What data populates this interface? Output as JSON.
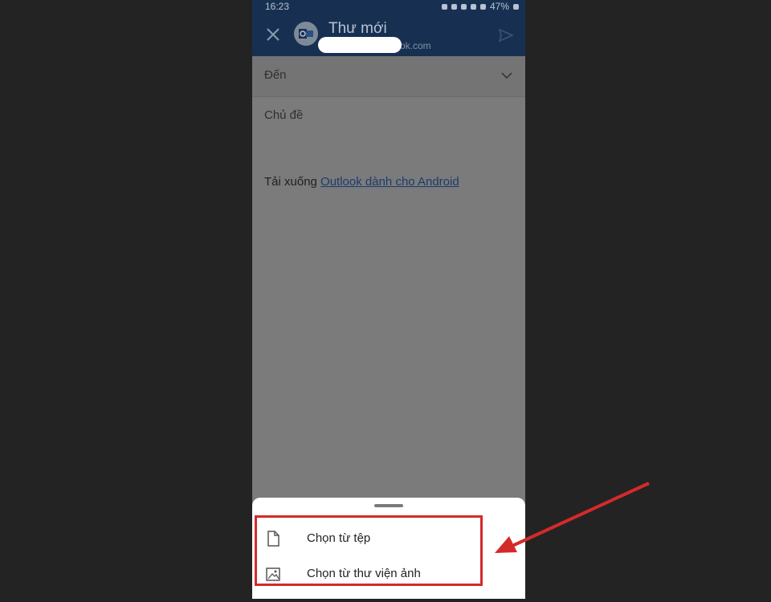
{
  "status_bar": {
    "time": "16:23",
    "battery": "47%"
  },
  "header": {
    "title": "Thư mới",
    "subtitle": "ok.com"
  },
  "compose": {
    "to_label": "Đến",
    "subject_label": "Chủ đề",
    "body_prefix": "Tải xuống ",
    "body_link": "Outlook dành cho Android"
  },
  "attach_sheet": {
    "items": [
      {
        "label": "Chọn từ tệp",
        "icon": "file-icon"
      },
      {
        "label": "Chọn từ thư viện ảnh",
        "icon": "image-icon"
      }
    ]
  },
  "colors": {
    "header_bg": "#173052",
    "overlay": "#7b7b7b",
    "annotation_red": "#d42a2a",
    "page_bg": "#232323"
  }
}
